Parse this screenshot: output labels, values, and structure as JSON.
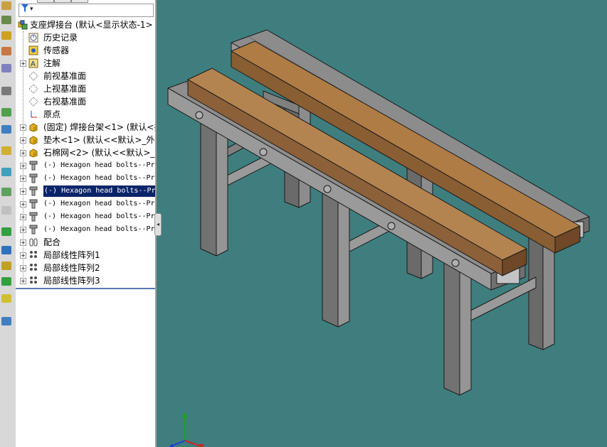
{
  "filter": {
    "icon": "filter-icon",
    "arrow": "▾"
  },
  "tree": {
    "root_label": "支座焊接台  (默认<显示状态-1>",
    "items": [
      {
        "label": "历史记录",
        "icon": "history-icon"
      },
      {
        "label": "传感器",
        "icon": "sensor-icon"
      },
      {
        "label": "注解",
        "icon": "annotation-icon"
      },
      {
        "label": "前视基准面",
        "icon": "plane-icon"
      },
      {
        "label": "上视基准面",
        "icon": "plane-icon"
      },
      {
        "label": "右视基准面",
        "icon": "plane-icon"
      },
      {
        "label": "原点",
        "icon": "origin-icon"
      },
      {
        "label": "(固定) 焊接台架<1> (默认<排",
        "icon": "part-icon"
      },
      {
        "label": "垫木<1> (默认<<默认>_外观",
        "icon": "part-icon"
      },
      {
        "label": "石棉网<2> (默认<<默认>_外观",
        "icon": "part-icon"
      },
      {
        "label": "(-) Hexagon head bolts--Pr",
        "icon": "bolt-icon"
      },
      {
        "label": "(-) Hexagon head bolts--Pr",
        "icon": "bolt-icon"
      },
      {
        "label": "(-) Hexagon head bolts--Pr",
        "icon": "bolt-icon"
      },
      {
        "label": "(-) Hexagon head bolts--Pr",
        "icon": "bolt-icon"
      },
      {
        "label": "(-) Hexagon head bolts--Pr",
        "icon": "bolt-icon"
      },
      {
        "label": "(-) Hexagon head bolts--Pr",
        "icon": "bolt-icon"
      },
      {
        "label": "配合",
        "icon": "mates-icon"
      },
      {
        "label": "局部线性阵列1",
        "icon": "pattern-icon"
      },
      {
        "label": "局部线性阵列2",
        "icon": "pattern-icon"
      },
      {
        "label": "局部线性阵列3",
        "icon": "pattern-icon"
      }
    ],
    "selected_index": 12
  },
  "colors": {
    "viewport_bg": "#3f7e7e",
    "steel": "#8a8a8a",
    "wood": "#9a7048",
    "selection": "#0a246a"
  }
}
